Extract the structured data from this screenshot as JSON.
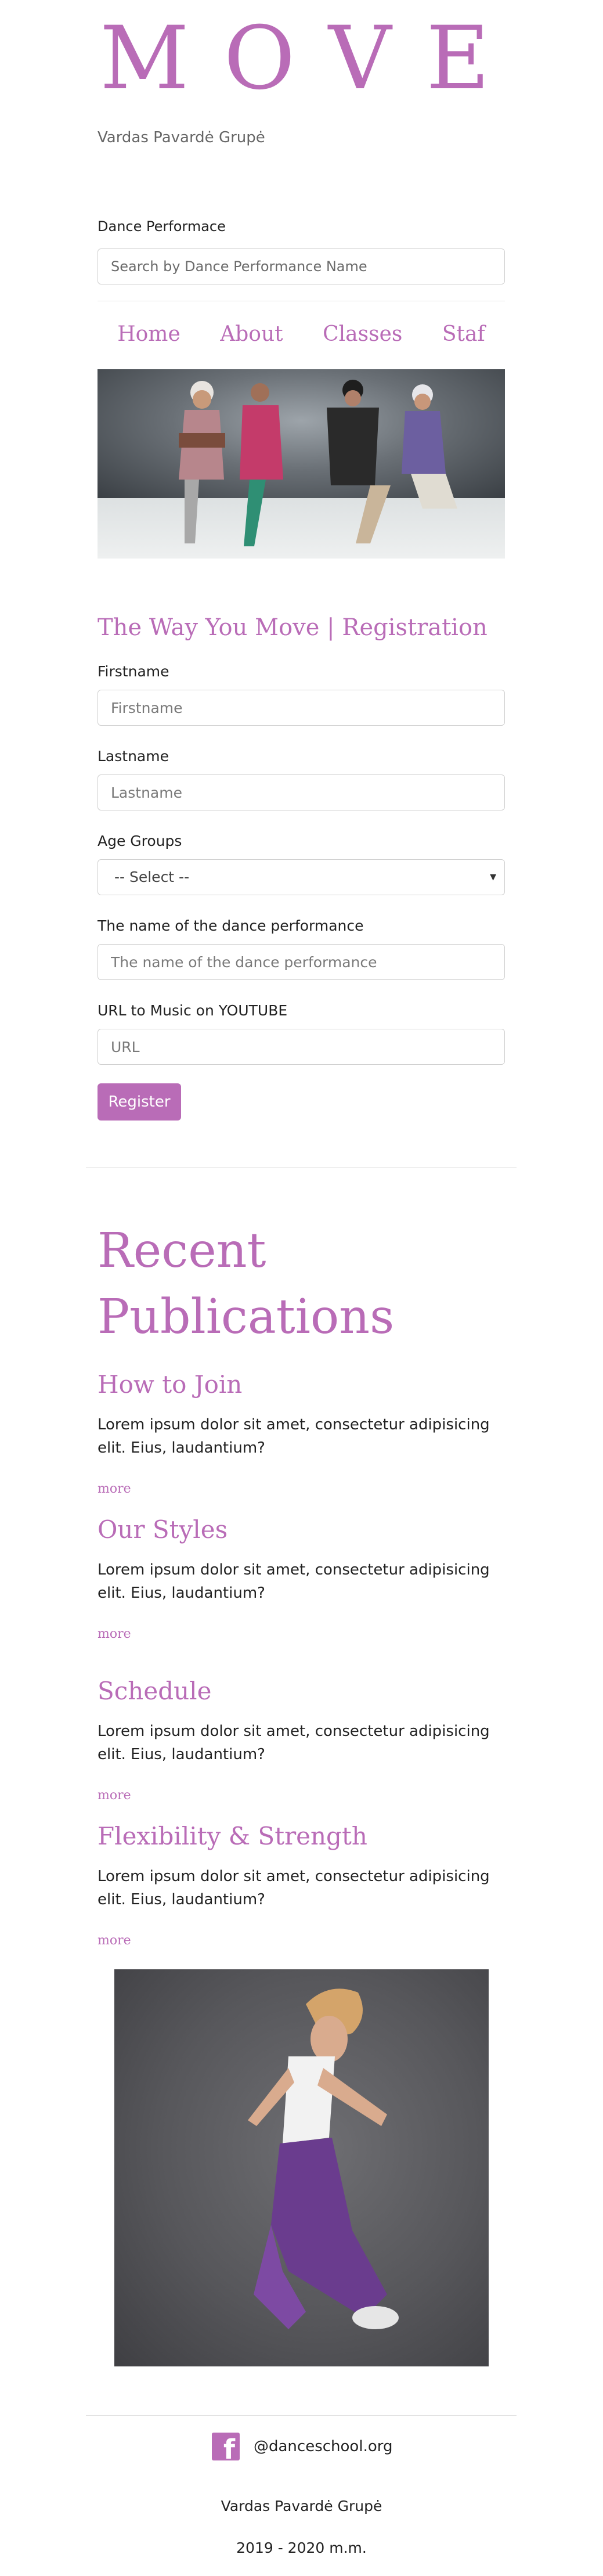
{
  "brand": {
    "logo": "MOVE",
    "tagline": "Vardas Pavardė Grupė",
    "accent": "#b96cb7"
  },
  "search": {
    "label": "Dance Performace",
    "placeholder": "Search by Dance Performance Name"
  },
  "nav": {
    "items": [
      "Home",
      "About",
      "Classes",
      "Staf"
    ]
  },
  "registration": {
    "title": "The Way You Move | Registration",
    "fields": [
      {
        "label": "Firstname",
        "placeholder": "Firstname"
      },
      {
        "label": "Lastname",
        "placeholder": "Lastname"
      },
      {
        "label": "Age Groups",
        "value": "-- Select --"
      },
      {
        "label": "The name of the dance performance",
        "placeholder": "The name of the dance performance"
      },
      {
        "label": "URL to Music on YOUTUBE",
        "placeholder": "URL"
      }
    ],
    "submit": "Register"
  },
  "publications": {
    "heading_line1": "Recent",
    "heading_line2": "Publications",
    "items": [
      {
        "title": "How to Join",
        "text": "Lorem ipsum dolor sit amet, consectetur adipisicing elit. Eius, laudantium?",
        "more": "more"
      },
      {
        "title": "Our Styles",
        "text": "Lorem ipsum dolor sit amet, consectetur adipisicing elit. Eius, laudantium?",
        "more": "more"
      },
      {
        "title": "Schedule",
        "text": "Lorem ipsum dolor sit amet, consectetur adipisicing elit. Eius, laudantium?",
        "more": "more"
      },
      {
        "title": "Flexibility & Strength",
        "text": "Lorem ipsum dolor sit amet, consectetur adipisicing elit. Eius, laudantium?",
        "more": "more"
      }
    ]
  },
  "footer": {
    "social_icon": "facebook-icon",
    "social_handle": "@danceschool.org",
    "name": "Vardas Pavardė Grupė",
    "years": "2019 - 2020 m.m."
  }
}
